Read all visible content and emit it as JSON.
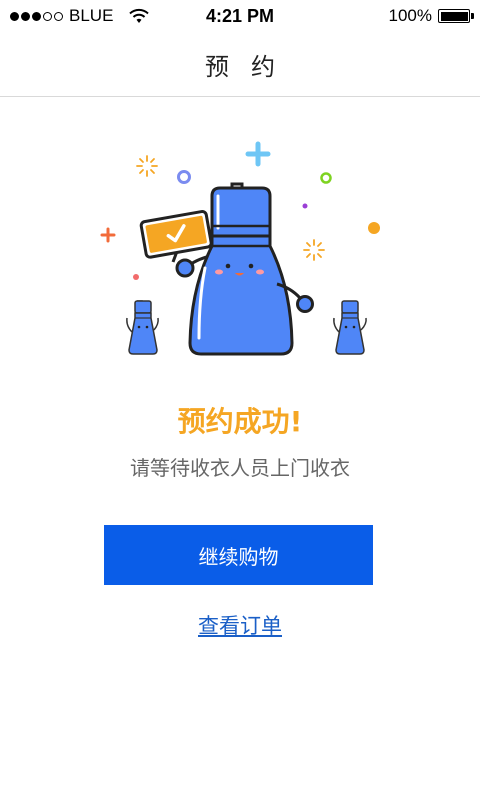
{
  "status_bar": {
    "carrier": "BLUE",
    "time": "4:21 PM",
    "battery": "100%",
    "battery_level": 1.0
  },
  "nav": {
    "title": "预约"
  },
  "result": {
    "title": "预约成功!",
    "subtitle": "请等待收衣人员上门收衣"
  },
  "actions": {
    "continue_label": "继续购物",
    "view_orders_label": "查看订单"
  },
  "colors": {
    "accent_blue": "#0a5de8",
    "success_orange": "#f5a623",
    "bottle_blue": "#4f86f7"
  }
}
